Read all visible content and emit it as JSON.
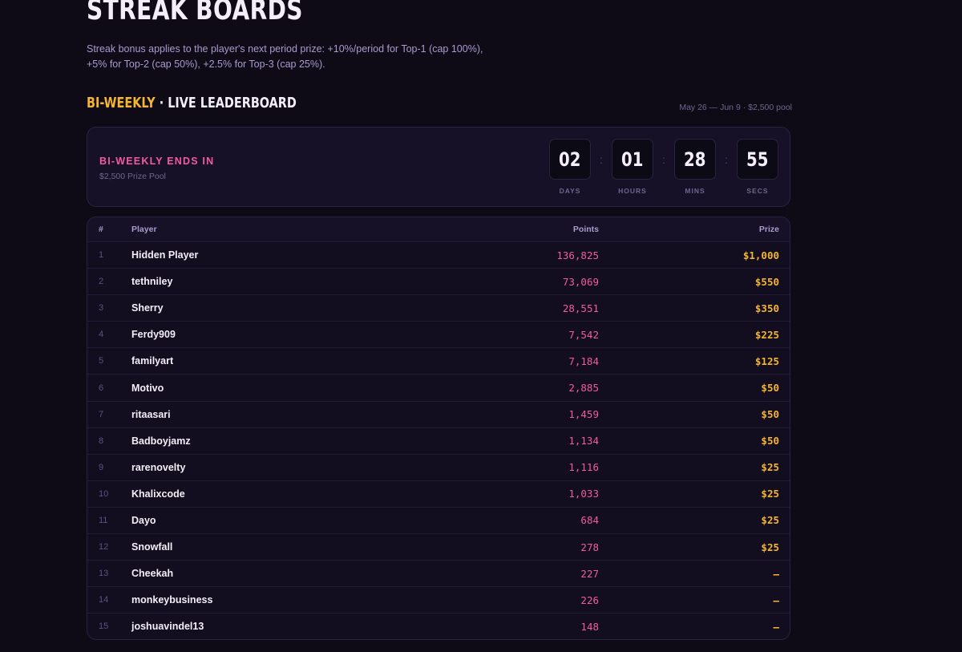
{
  "page": {
    "title": "Streak Boards",
    "subtitle": "Streak bonus applies to the player's next period prize: +10%/period for Top-1 (cap 100%), +5% for Top-2 (cap 50%), +2.5% for Top-3 (cap 25%)."
  },
  "section": {
    "accent": "Bi-Weekly",
    "dot": " · ",
    "rest": "Live Leaderboard",
    "meta": "May 26 — Jun 9 · $2,500 pool"
  },
  "countdown": {
    "label": "Bi-Weekly Ends In",
    "pool": "$2,500 Prize Pool",
    "separator": ":",
    "units": [
      {
        "value": "02",
        "label": "DAYS"
      },
      {
        "value": "01",
        "label": "HOURS"
      },
      {
        "value": "28",
        "label": "MINS"
      },
      {
        "value": "55",
        "label": "SECS"
      }
    ]
  },
  "table": {
    "headers": {
      "rank": "#",
      "player": "Player",
      "points": "Points",
      "prize": "Prize"
    },
    "rows": [
      {
        "rank": "1",
        "player": "Hidden Player",
        "points": "136,825",
        "prize": "$1,000"
      },
      {
        "rank": "2",
        "player": "tethniley",
        "points": "73,069",
        "prize": "$550"
      },
      {
        "rank": "3",
        "player": "Sherry",
        "points": "28,551",
        "prize": "$350"
      },
      {
        "rank": "4",
        "player": "Ferdy909",
        "points": "7,542",
        "prize": "$225"
      },
      {
        "rank": "5",
        "player": "familyart",
        "points": "7,184",
        "prize": "$125"
      },
      {
        "rank": "6",
        "player": "Motivo",
        "points": "2,885",
        "prize": "$50"
      },
      {
        "rank": "7",
        "player": "ritaasari",
        "points": "1,459",
        "prize": "$50"
      },
      {
        "rank": "8",
        "player": "Badboyjamz",
        "points": "1,134",
        "prize": "$50"
      },
      {
        "rank": "9",
        "player": "rarenovelty",
        "points": "1,116",
        "prize": "$25"
      },
      {
        "rank": "10",
        "player": "Khalixcode",
        "points": "1,033",
        "prize": "$25"
      },
      {
        "rank": "11",
        "player": "Dayo",
        "points": "684",
        "prize": "$25"
      },
      {
        "rank": "12",
        "player": "Snowfall",
        "points": "278",
        "prize": "$25"
      },
      {
        "rank": "13",
        "player": "Cheekah",
        "points": "227",
        "prize": "—"
      },
      {
        "rank": "14",
        "player": "monkeybusiness",
        "points": "226",
        "prize": "—"
      },
      {
        "rank": "15",
        "player": "joshuavindel13",
        "points": "148",
        "prize": "—"
      }
    ]
  },
  "colors": {
    "background": "#0e0b17",
    "accent_gold": "#f5b530",
    "accent_pink": "#f25b9e",
    "muted": "#6f6691"
  }
}
